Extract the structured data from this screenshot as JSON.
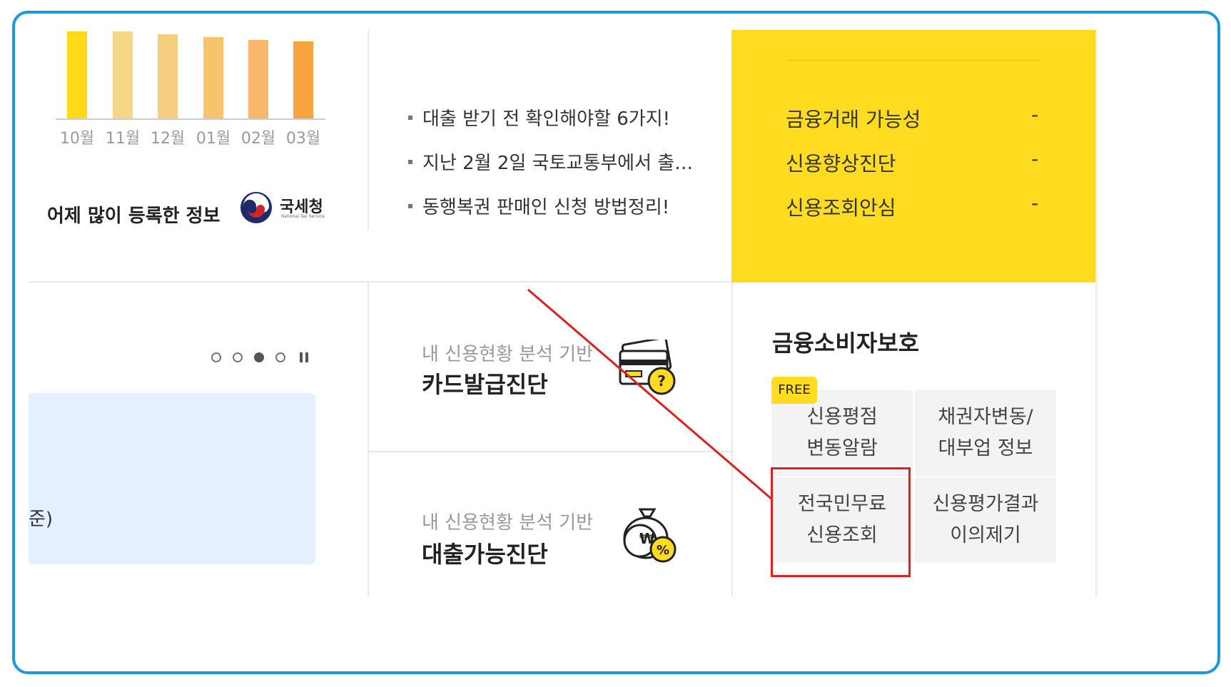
{
  "trend_chart": {
    "type": "bar",
    "categories": [
      "10월",
      "11월",
      "12월",
      "01월",
      "02월",
      "03월"
    ],
    "colors": [
      "#ffd91a",
      "#f5d78a",
      "#f5cd7f",
      "#f5c46d",
      "#f8b76a",
      "#f9a33f"
    ]
  },
  "popular_info": {
    "title": "어제 많이 등록한 정보",
    "agency_name": "국세청",
    "agency_sub": "National Tax Service"
  },
  "news": {
    "items": [
      "대출 받기 전 확인해야할 6가지!",
      "지난 2월 2일 국토교통부에서 출…",
      "동행복권 판매인 신청 방법정리!"
    ]
  },
  "credit_panel": {
    "rows": [
      {
        "label": "금융거래 가능성",
        "value": "-"
      },
      {
        "label": "신용향상진단",
        "value": "-"
      },
      {
        "label": "신용조회안심",
        "value": "-"
      }
    ]
  },
  "banner": {
    "text_fragment": "준)",
    "pager": [
      "o",
      "o",
      "active",
      "o"
    ]
  },
  "diagnostics": [
    {
      "sub": "내 신용현황 분석 기반",
      "title": "카드발급진단",
      "icon": "card-question-icon"
    },
    {
      "sub": "내 신용현황 분석 기반",
      "title": "대출가능진단",
      "icon": "money-bag-percent-icon"
    }
  ],
  "consumer_protection": {
    "title": "금융소비자보호",
    "badge": "FREE",
    "items": [
      {
        "line1": "신용평점",
        "line2": "변동알람"
      },
      {
        "line1": "채권자변동/",
        "line2": "대부업 정보"
      },
      {
        "line1": "전국민무료",
        "line2": "신용조회"
      },
      {
        "line1": "신용평가결과",
        "line2": "이의제기"
      }
    ]
  },
  "colors": {
    "frame": "#1b9ad9",
    "panel_yellow": "#ffdc1f",
    "highlight_red": "#e0201f"
  }
}
